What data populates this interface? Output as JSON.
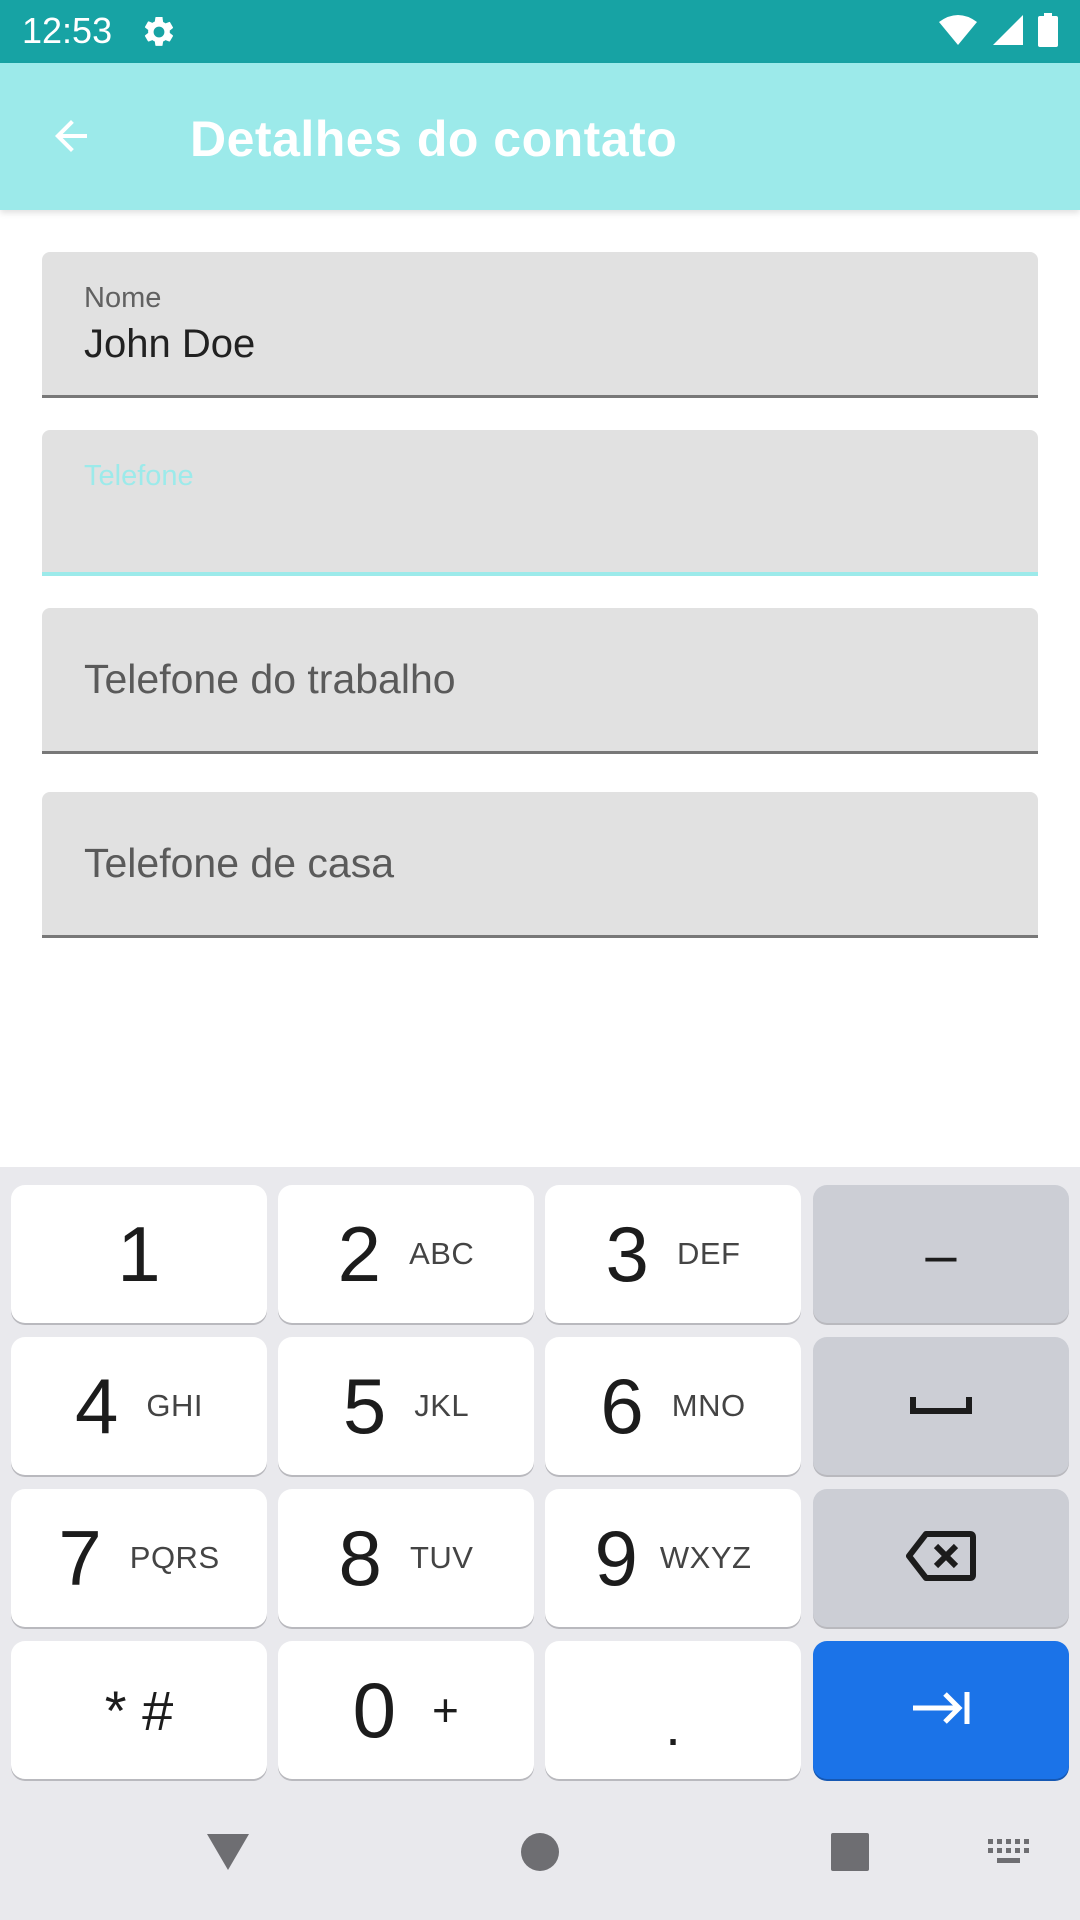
{
  "status_bar": {
    "time": "12:53",
    "icons": [
      "gear-icon",
      "wifi-icon",
      "signal-icon",
      "battery-icon"
    ]
  },
  "app_bar": {
    "title": "Detalhes do contato",
    "back_icon": "arrow-left-icon"
  },
  "form": {
    "fields": [
      {
        "label": "Nome",
        "value": "John Doe"
      },
      {
        "label": "Telefone",
        "value": ""
      },
      {
        "placeholder": "Telefone do trabalho"
      },
      {
        "placeholder": "Telefone de casa"
      }
    ]
  },
  "keyboard": {
    "keys": [
      {
        "main": "1",
        "sub": ""
      },
      {
        "main": "2",
        "sub": "ABC"
      },
      {
        "main": "3",
        "sub": "DEF"
      },
      {
        "main": "–",
        "sub": ""
      },
      {
        "main": "4",
        "sub": "GHI"
      },
      {
        "main": "5",
        "sub": "JKL"
      },
      {
        "main": "6",
        "sub": "MNO"
      },
      {
        "main": "",
        "icon": "space-icon"
      },
      {
        "main": "7",
        "sub": "PQRS"
      },
      {
        "main": "8",
        "sub": "TUV"
      },
      {
        "main": "9",
        "sub": "WXYZ"
      },
      {
        "main": "",
        "icon": "backspace-icon"
      },
      {
        "main": "* #",
        "sub": ""
      },
      {
        "main": "0",
        "sub": "+"
      },
      {
        "main": ".",
        "sub": ""
      },
      {
        "main": "",
        "icon": "next-icon"
      }
    ],
    "accent_color": "#1b73e8"
  },
  "nav_bar": {
    "icons": [
      "back-triangle-icon",
      "home-circle-icon",
      "recents-square-icon",
      "keyboard-switch-icon"
    ]
  },
  "colors": {
    "status_bar": "#17a3a4",
    "app_bar": "#9ceaea",
    "field_bg": "#e1e1e1",
    "focus_accent": "#9ceaea"
  }
}
